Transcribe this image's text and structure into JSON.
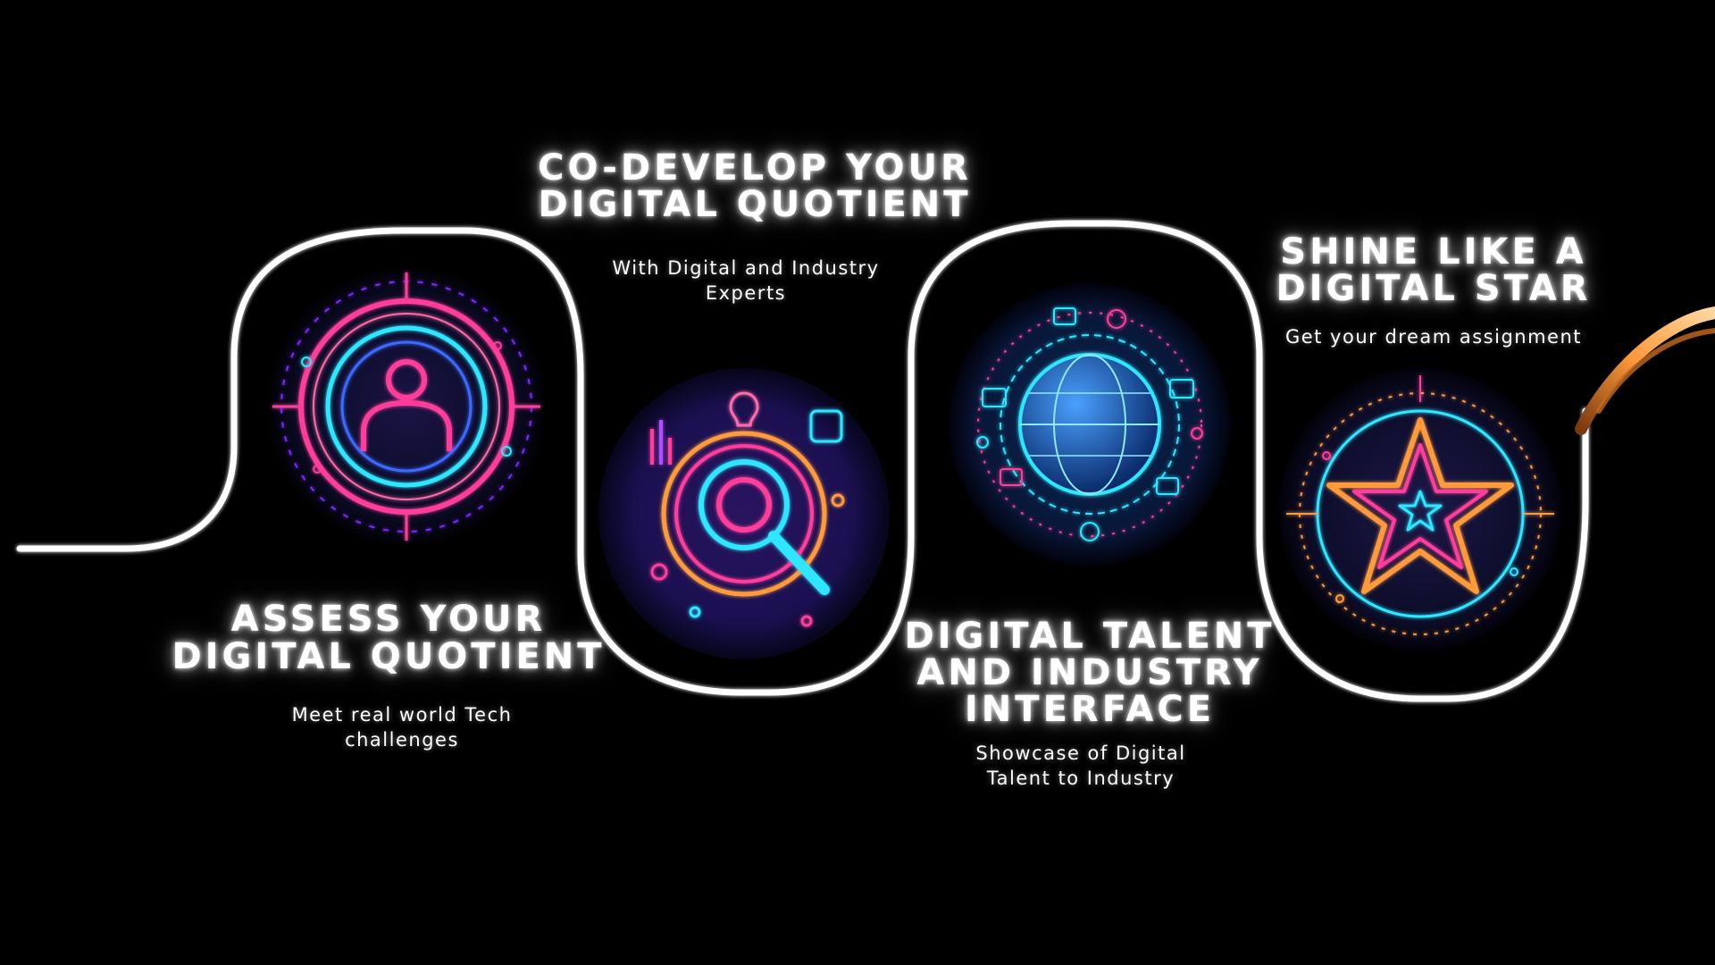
{
  "colors": {
    "background": "#000000",
    "path": "#ffffff",
    "neon_pink": "#ff3d9a",
    "neon_cyan": "#2ee6ff",
    "neon_blue": "#3a6bff",
    "neon_orange": "#ff9a3c",
    "neon_purple": "#b04dff"
  },
  "steps": [
    {
      "title": "ASSESS YOUR\nDIGITAL QUOTIENT",
      "subtitle": "Meet real world Tech\nchallenges",
      "icon": "person-target-icon"
    },
    {
      "title": "CO-DEVELOP YOUR\nDIGITAL QUOTIENT",
      "subtitle": "With Digital and Industry\nExperts",
      "icon": "magnifier-icon"
    },
    {
      "title": "DIGITAL TALENT\nAND INDUSTRY\nINTERFACE",
      "subtitle": "Showcase of Digital\nTalent to Industry",
      "icon": "globe-network-icon"
    },
    {
      "title": "SHINE LIKE A\nDIGITAL STAR",
      "subtitle": "Get your dream assignment",
      "icon": "star-icon"
    }
  ]
}
